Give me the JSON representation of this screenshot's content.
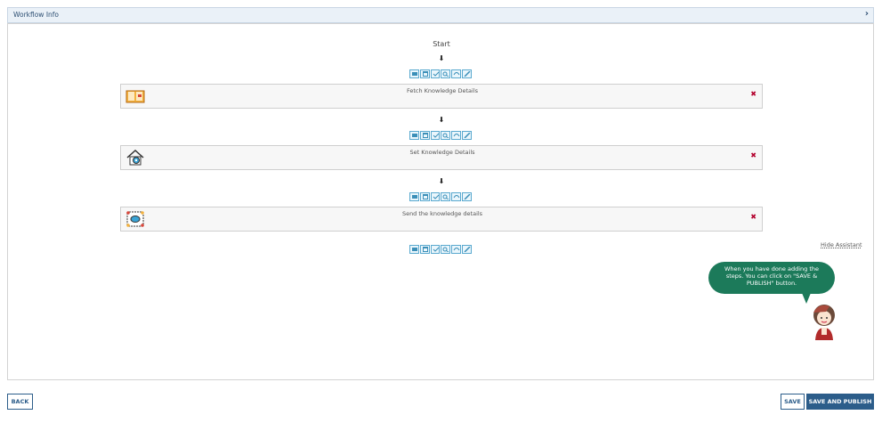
{
  "header": {
    "title": "Workflow Info",
    "chevron_icon": "chevron-right-icon"
  },
  "workflow": {
    "start_label": "Start",
    "arrow": "⬇",
    "toolbar_icons": [
      "card-icon",
      "calendar-icon",
      "check-list-icon",
      "search-icon",
      "loop-icon",
      "edit-icon"
    ],
    "steps": [
      {
        "label": "Fetch Knowledge Details",
        "icon": "book-icon",
        "remove": "✖"
      },
      {
        "label": "Set Knowledge Details",
        "icon": "house-gear-icon",
        "remove": "✖"
      },
      {
        "label": "Send the knowledge details",
        "icon": "chat-network-icon",
        "remove": "✖"
      }
    ]
  },
  "assistant": {
    "hide_label": "Hide Assistant",
    "message": "When you have done adding the steps. You can click on \"SAVE & PUBLISH\" button."
  },
  "footer": {
    "back": "BACK",
    "save": "SAVE",
    "save_publish": "SAVE AND PUBLISH"
  },
  "colors": {
    "primary": "#2c5d8a",
    "assistant_bubble": "#1c7a5a",
    "remove": "#b3002d",
    "toolbar": "#5aa9cf"
  }
}
